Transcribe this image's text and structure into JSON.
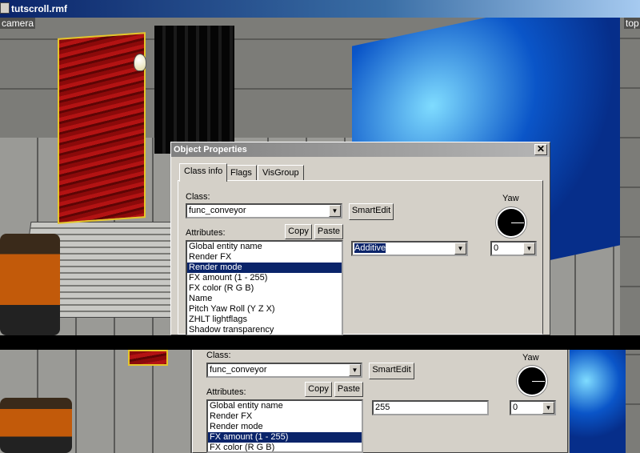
{
  "window": {
    "title": "tutscroll.rmf"
  },
  "viewport_top": {
    "label": "camera",
    "right_label": "top"
  },
  "viewport_bottom": {},
  "dialog1": {
    "title": "Object Properties",
    "close_glyph": "✕",
    "tabs": [
      "Class info",
      "Flags",
      "VisGroup"
    ],
    "class_label": "Class:",
    "class_value": "func_conveyor",
    "smartedit_label": "SmartEdit",
    "yaw_label": "Yaw",
    "attributes_label": "Attributes:",
    "copy_label": "Copy",
    "paste_label": "Paste",
    "attributes": [
      "Global entity name",
      "Render FX",
      "Render mode",
      "FX amount (1 - 255)",
      "FX color (R G B)",
      "Name",
      "Pitch Yaw Roll (Y Z X)",
      "ZHLT lightflags",
      "Shadow transparency"
    ],
    "selected_index": 2,
    "value_field": "Additive",
    "yaw_value": "0"
  },
  "dialog2": {
    "class_label": "Class:",
    "class_value": "func_conveyor",
    "smartedit_label": "SmartEdit",
    "yaw_label": "Yaw",
    "attributes_label": "Attributes:",
    "copy_label": "Copy",
    "paste_label": "Paste",
    "attributes": [
      "Global entity name",
      "Render FX",
      "Render mode",
      "FX amount (1 - 255)",
      "FX color (R G B)"
    ],
    "selected_index": 3,
    "value_field": "255",
    "yaw_value": "0"
  },
  "colors": {
    "selection": "#0a246a",
    "dialog_bg": "#d4d0c8",
    "titlebar": "#0a246a"
  },
  "icons": {
    "dropdown": "▼",
    "bulb": "light-bulb-icon",
    "document": "document-icon"
  }
}
